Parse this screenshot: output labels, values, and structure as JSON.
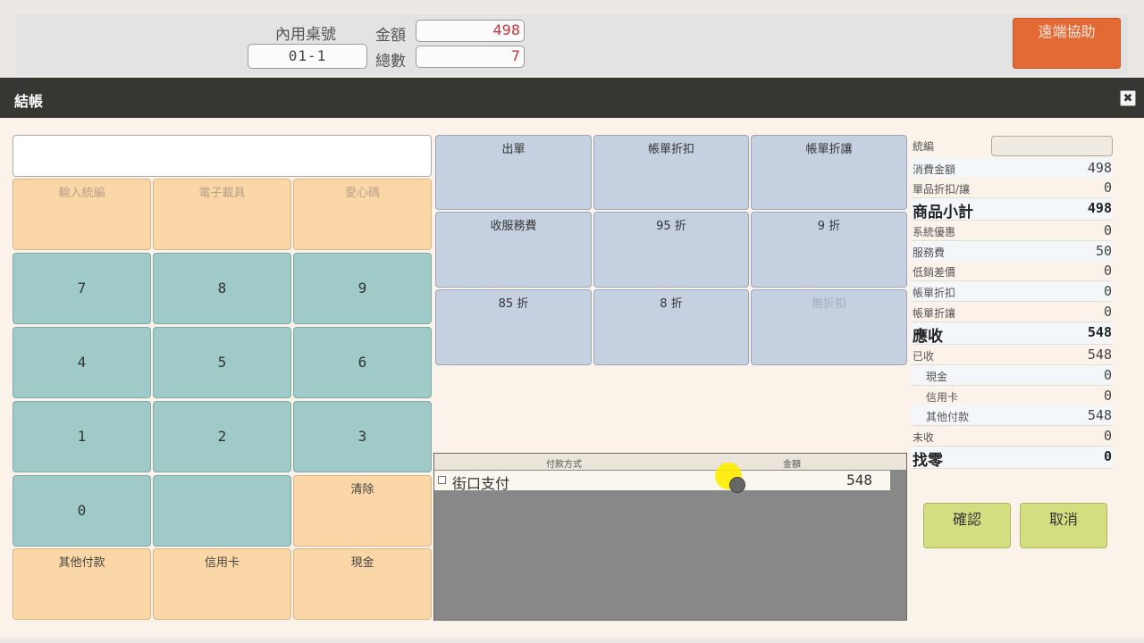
{
  "header": {
    "table_label": "內用桌號",
    "table_value": "01-1",
    "amount_label": "金額",
    "amount_value": "498",
    "count_label": "總數",
    "count_value": "7",
    "remote_help": "遠端協助",
    "accent_color": "#e36a35"
  },
  "dialog": {
    "title": "結帳",
    "close_glyph": "✖"
  },
  "keypad": {
    "top_buttons": [
      "輸入統編",
      "電子載具",
      "愛心碼"
    ],
    "digits": [
      "7",
      "8",
      "9",
      "4",
      "5",
      "6",
      "1",
      "2",
      "3",
      "0"
    ],
    "clear": "清除",
    "payments": [
      "其他付款",
      "信用卡",
      "現金"
    ]
  },
  "discounts": {
    "buttons": [
      "出單",
      "帳單折扣",
      "帳單折讓",
      "收服務費",
      "95 折",
      "9 折",
      "85 折",
      "8 折",
      "無折扣"
    ]
  },
  "payment_table": {
    "columns": [
      "付款方式",
      "金額"
    ],
    "rows": [
      {
        "method": "街口支付",
        "amount": "548"
      }
    ]
  },
  "summary": {
    "tax_id_label": "統編",
    "rows": [
      {
        "label": "消費金額",
        "value": "498"
      },
      {
        "label": "單品折扣/讓",
        "value": "0"
      },
      {
        "label": "商品小計",
        "value": "498"
      },
      {
        "label": "系統優惠",
        "value": "0"
      },
      {
        "label": "服務費",
        "value": "50"
      },
      {
        "label": "低銷差價",
        "value": "0"
      },
      {
        "label": "帳單折扣",
        "value": "0"
      },
      {
        "label": "帳單折讓",
        "value": "0"
      },
      {
        "label": "應收",
        "value": "548"
      },
      {
        "label": "已收",
        "value": "548"
      },
      {
        "label": "現金",
        "value": "0"
      },
      {
        "label": "信用卡",
        "value": "0"
      },
      {
        "label": "其他付款",
        "value": "548"
      },
      {
        "label": "未收",
        "value": "0"
      },
      {
        "label": "找零",
        "value": "0"
      }
    ]
  },
  "actions": {
    "confirm": "確認",
    "cancel": "取消"
  }
}
